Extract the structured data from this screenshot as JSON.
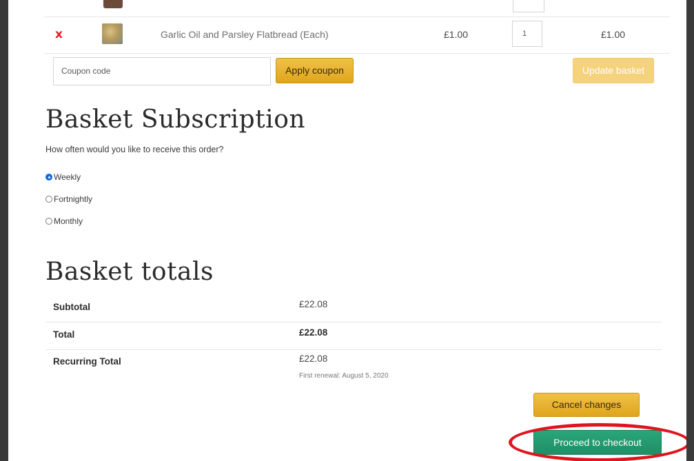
{
  "cart": {
    "item": {
      "remove_symbol": "x",
      "name": "Garlic Oil and Parsley Flatbread (Each)",
      "price": "£1.00",
      "quantity": "1",
      "subtotal": "£1.00"
    },
    "coupon_placeholder": "Coupon code",
    "apply_coupon_label": "Apply coupon",
    "update_basket_label": "Update basket"
  },
  "subscription": {
    "title": "Basket Subscription",
    "question": "How often would you like to receive this order?",
    "options": [
      {
        "label": "Weekly",
        "checked": true
      },
      {
        "label": "Fortnightly",
        "checked": false
      },
      {
        "label": "Monthly",
        "checked": false
      }
    ]
  },
  "totals": {
    "title": "Basket totals",
    "subtotal_label": "Subtotal",
    "subtotal_value": "£22.08",
    "total_label": "Total",
    "total_value": "£22.08",
    "recurring_label": "Recurring Total",
    "recurring_value": "£22.08",
    "first_renewal": "First renewal: August 5, 2020"
  },
  "actions": {
    "cancel_label": "Cancel changes",
    "checkout_label": "Proceed to checkout"
  },
  "colors": {
    "gold_button": "#e0a51b",
    "checkout_green": "#1f8f67",
    "remove_red": "#e31b23",
    "highlight_red": "#e0141e"
  }
}
